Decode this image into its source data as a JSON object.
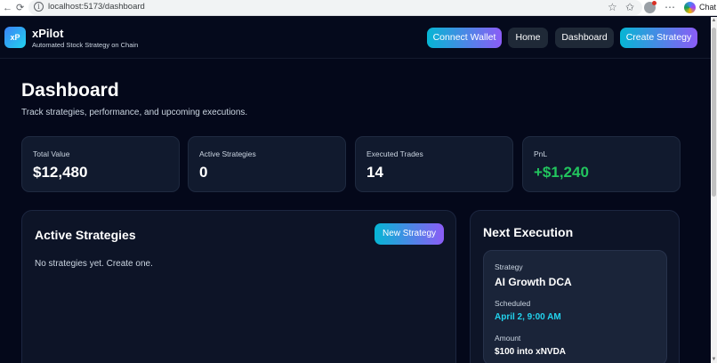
{
  "browser": {
    "back": "←",
    "reload": "⟳",
    "url": "localhost:5173/dashboard",
    "chat_label": "Chat"
  },
  "header": {
    "logo_text": "xP",
    "brand": "xPilot",
    "tagline": "Automated Stock Strategy on Chain",
    "nav": {
      "connect_wallet": "Connect Wallet",
      "home": "Home",
      "dashboard": "Dashboard",
      "create_strategy": "Create Strategy"
    }
  },
  "dashboard": {
    "title": "Dashboard",
    "subtitle": "Track strategies, performance, and upcoming executions.",
    "stats": [
      {
        "label": "Total Value",
        "value": "$12,480"
      },
      {
        "label": "Active Strategies",
        "value": "0"
      },
      {
        "label": "Executed Trades",
        "value": "14"
      },
      {
        "label": "PnL",
        "value": "+$1,240"
      }
    ],
    "active_strategies": {
      "title": "Active Strategies",
      "new_button": "New Strategy",
      "empty": "No strategies yet. Create one."
    },
    "next_execution": {
      "title": "Next Execution",
      "strategy_label": "Strategy",
      "strategy_value": "AI Growth DCA",
      "scheduled_label": "Scheduled",
      "scheduled_value": "April 2, 9:00 AM",
      "amount_label": "Amount",
      "amount_value": "$100 into xNVDA"
    }
  },
  "colors": {
    "background": "#04081a",
    "accent_start": "#06b6d4",
    "accent_end": "#8b5cf6",
    "positive": "#22c55e",
    "scheduled": "#22d3ee"
  }
}
